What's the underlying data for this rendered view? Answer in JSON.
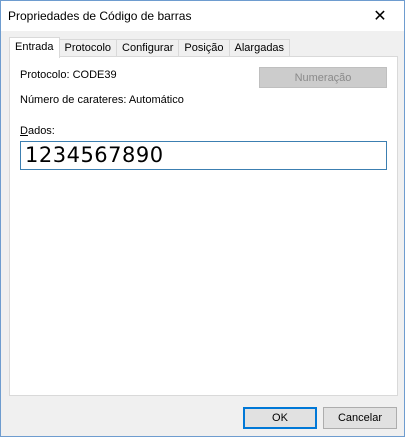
{
  "window": {
    "title": "Propriedades de Código de barras",
    "close_glyph": "✕"
  },
  "tabs": [
    {
      "label": "Entrada",
      "active": true
    },
    {
      "label": "Protocolo",
      "active": false
    },
    {
      "label": "Configurar",
      "active": false
    },
    {
      "label": "Posição",
      "active": false
    },
    {
      "label": "Alargadas",
      "active": false
    }
  ],
  "entrada": {
    "protocolo_label": "Protocolo: CODE39",
    "numero_caracteres_label": "Número de carateres: Automático",
    "numeracao_button": "Numeração",
    "dados_label_mnemonic": "D",
    "dados_label_rest": "ados:",
    "dados_value": "1234567890"
  },
  "footer": {
    "ok_label": "OK",
    "cancel_label": "Cancelar"
  },
  "colors": {
    "accent": "#0078d7",
    "input_border": "#3c7fb1",
    "disabled_button": "#cccccc"
  },
  "icons": {
    "close": "close-icon"
  }
}
